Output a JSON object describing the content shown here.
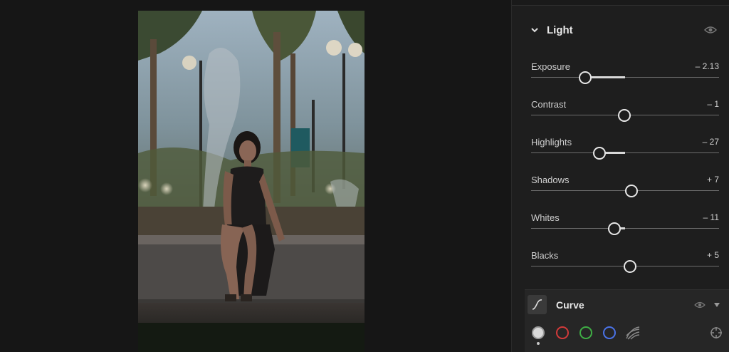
{
  "panel": {
    "section_title": "Light",
    "sliders": [
      {
        "label": "Exposure",
        "value_text": "– 2.13",
        "value": -2.13,
        "min": -5,
        "max": 5
      },
      {
        "label": "Contrast",
        "value_text": "– 1",
        "value": -1,
        "min": -100,
        "max": 100
      },
      {
        "label": "Highlights",
        "value_text": "– 27",
        "value": -27,
        "min": -100,
        "max": 100
      },
      {
        "label": "Shadows",
        "value_text": "+ 7",
        "value": 7,
        "min": -100,
        "max": 100
      },
      {
        "label": "Whites",
        "value_text": "– 11",
        "value": -11,
        "min": -100,
        "max": 100
      },
      {
        "label": "Blacks",
        "value_text": "+ 5",
        "value": 5,
        "min": -100,
        "max": 100
      }
    ]
  },
  "curve": {
    "title": "Curve",
    "channels": [
      "rgb",
      "red",
      "green",
      "blue"
    ],
    "selected_channel": "rgb"
  },
  "icons": {
    "collapse": "chevron-down-icon",
    "visibility": "eye-icon",
    "curve": "tone-curve-icon",
    "dropdown": "triangle-down-icon",
    "parametric": "parametric-curve-icon",
    "targeted_adjust": "target-icon"
  },
  "colors": {
    "panel_bg": "#1e1e1e",
    "canvas_bg": "#161616",
    "red_channel": "#d23a3a",
    "green_channel": "#3fae45",
    "blue_channel": "#4a73e8"
  }
}
